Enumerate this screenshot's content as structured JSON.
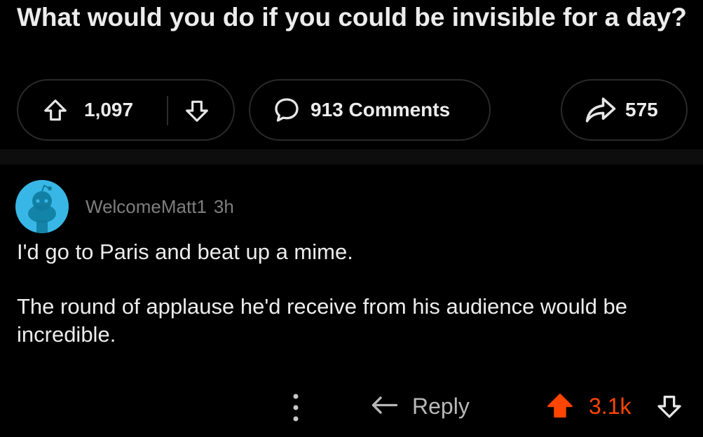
{
  "post": {
    "title": "What would you do if you could be invisible for a day?"
  },
  "actions": {
    "upvotes": "1,097",
    "comments": "913 Comments",
    "shares": "575"
  },
  "comment": {
    "username": "WelcomeMatt1",
    "time": "3h",
    "paragraphs": [
      "I'd go to Paris and beat up a mime.",
      "The round of applause he'd receive from his audience would be incredible."
    ],
    "reply_label": "Reply",
    "score": "3.1k",
    "score_color": "#ff4500"
  },
  "colors": {
    "background": "#000000",
    "avatar": "#38b7e6",
    "upvote_active": "#ff4500"
  },
  "icons": {
    "upvote": "arrow-up-outline-icon",
    "downvote": "arrow-down-outline-icon",
    "comments": "speech-bubble-icon",
    "share": "share-arrow-icon",
    "reply": "reply-arrow-icon",
    "more": "vertical-dots-icon",
    "upvote_active": "arrow-up-filled-icon"
  }
}
